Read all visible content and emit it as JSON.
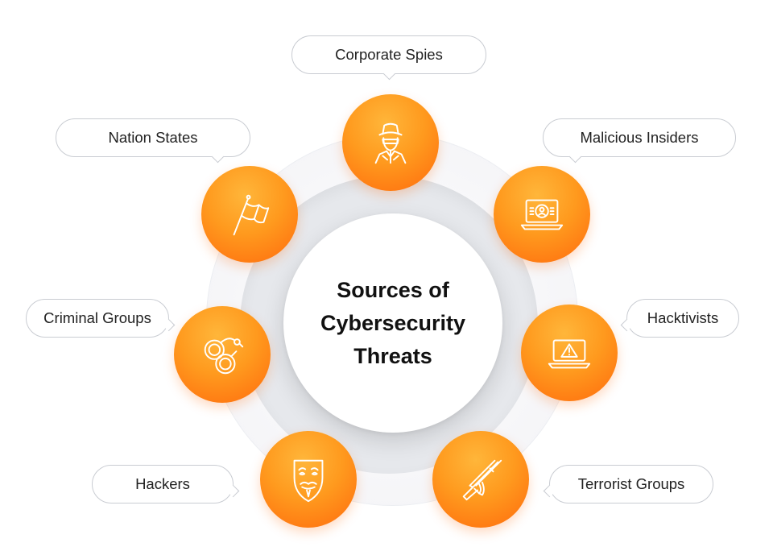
{
  "diagram": {
    "title": "Sources of\nCybersecurity\nThreats",
    "accent_color": "#ff8a12",
    "nodes": [
      {
        "label": "Corporate Spies",
        "icon": "spy-icon"
      },
      {
        "label": "Malicious Insiders",
        "icon": "laptop-user-icon"
      },
      {
        "label": "Hacktivists",
        "icon": "laptop-warning-icon"
      },
      {
        "label": "Terrorist Groups",
        "icon": "rifle-icon"
      },
      {
        "label": "Hackers",
        "icon": "mask-icon"
      },
      {
        "label": "Criminal Groups",
        "icon": "handcuffs-icon"
      },
      {
        "label": "Nation States",
        "icon": "flag-icon"
      }
    ]
  }
}
